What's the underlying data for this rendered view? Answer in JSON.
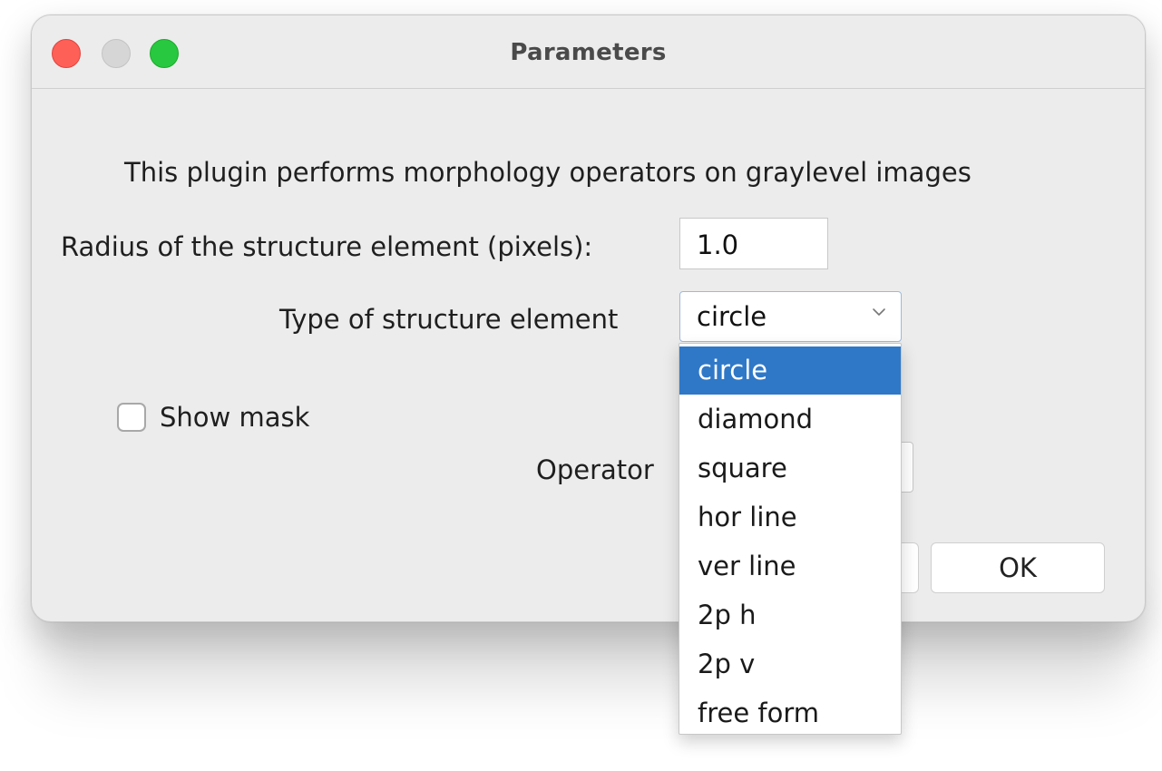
{
  "window": {
    "title": "Parameters"
  },
  "dialog": {
    "description": "This plugin performs morphology operators on graylevel images",
    "radius_label": "Radius of the structure element (pixels):",
    "radius_value": "1.0",
    "type_label": "Type of structure element",
    "type_value": "circle",
    "show_mask_label": "Show mask",
    "show_mask_checked": false,
    "operator_label": "Operator",
    "ok_label": "OK"
  },
  "dropdown": {
    "options": [
      "circle",
      "diamond",
      "square",
      "hor line",
      "ver line",
      "2p h",
      "2p v",
      "free form"
    ],
    "selected_index": 0
  },
  "icons": {
    "chevron": "chevron-down-icon"
  },
  "colors": {
    "selected": "#2f78c7",
    "close": "#fe5f57",
    "minimize": "#d6d6d6",
    "maximize": "#28c840"
  }
}
